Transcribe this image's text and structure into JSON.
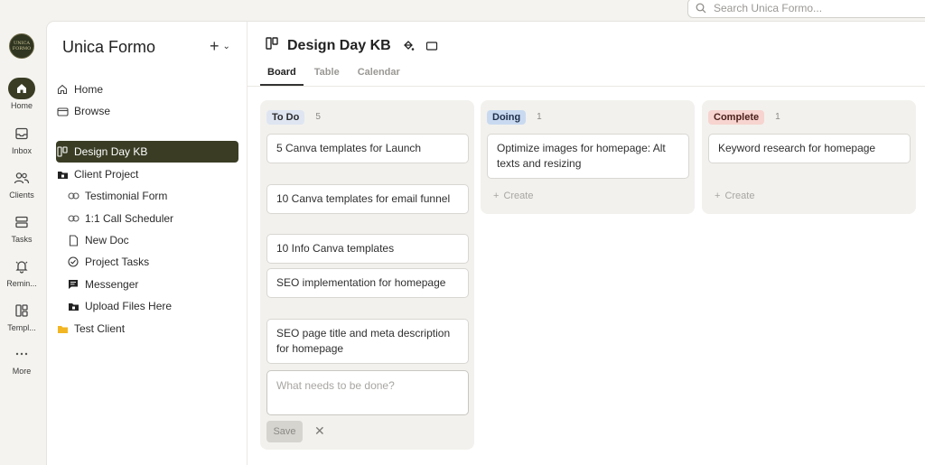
{
  "search": {
    "placeholder": "Search Unica Formo..."
  },
  "rail": {
    "logo_text": "UNICA FORMO",
    "items": [
      {
        "label": "Home",
        "icon": "home-icon"
      },
      {
        "label": "Inbox",
        "icon": "inbox-icon"
      },
      {
        "label": "Clients",
        "icon": "clients-icon"
      },
      {
        "label": "Tasks",
        "icon": "tasks-icon"
      },
      {
        "label": "Remin...",
        "icon": "bell-icon"
      },
      {
        "label": "Templ...",
        "icon": "template-icon"
      },
      {
        "label": "More",
        "icon": "more-icon"
      }
    ]
  },
  "sidebar": {
    "title": "Unica Formo",
    "add": "+",
    "items": [
      {
        "label": "Home",
        "icon": "home-icon"
      },
      {
        "label": "Browse",
        "icon": "browse-icon"
      },
      {
        "label": "Design Day KB",
        "icon": "board-icon"
      },
      {
        "label": "Client Project",
        "icon": "folder-icon"
      },
      {
        "label": "Testimonial Form",
        "icon": "link-icon"
      },
      {
        "label": "1:1 Call Scheduler",
        "icon": "link-icon"
      },
      {
        "label": "New Doc",
        "icon": "doc-icon"
      },
      {
        "label": "Project Tasks",
        "icon": "check-circle-icon"
      },
      {
        "label": "Messenger",
        "icon": "chat-icon"
      },
      {
        "label": "Upload Files Here",
        "icon": "upload-folder-icon"
      },
      {
        "label": "Test Client",
        "icon": "folder-icon"
      }
    ]
  },
  "board": {
    "title": "Design Day KB",
    "tabs": [
      "Board",
      "Table",
      "Calendar"
    ],
    "columns": [
      {
        "name": "To Do",
        "count": "5",
        "color": "#dfe6f2",
        "text_color": "#2b2b2b",
        "cards": [
          "5 Canva templates for Launch",
          "10 Canva templates for email funnel",
          "10 Info Canva templates",
          "SEO implementation for homepage",
          "SEO page title and meta description for homepage"
        ],
        "new_placeholder": "What needs to be done?",
        "save_label": "Save"
      },
      {
        "name": "Doing",
        "count": "1",
        "color": "#c9daf0",
        "text_color": "#1f2f4a",
        "cards": [
          "Optimize images for homepage: Alt texts and resizing"
        ],
        "create_label": "Create"
      },
      {
        "name": "Complete",
        "count": "1",
        "color": "#f7d4cf",
        "text_color": "#4a1f1a",
        "cards": [
          "Keyword research for homepage"
        ],
        "create_label": "Create"
      }
    ]
  }
}
